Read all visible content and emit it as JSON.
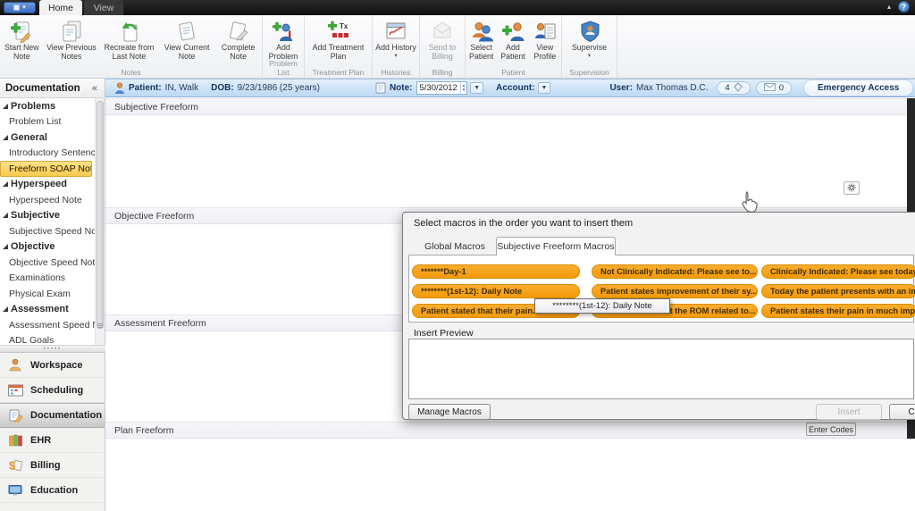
{
  "titlebar": {
    "tabs": [
      {
        "label": "Home",
        "active": true
      },
      {
        "label": "View",
        "active": false
      }
    ]
  },
  "glyphs": {
    "chevron_down": "▾",
    "collapse_caret": "▴",
    "question": "?",
    "spinner_up": "▲",
    "spinner_down": "▼",
    "left_chevrons": "«",
    "splitter_dots": "•••••"
  },
  "icons": [
    "new-note-icon",
    "previous-notes-icon",
    "recreate-note-icon",
    "current-note-icon",
    "complete-note-icon",
    "add-problem-icon",
    "add-treatment-plan-icon",
    "add-history-icon",
    "send-to-billing-icon",
    "select-patient-icon",
    "add-patient-icon",
    "view-profile-icon",
    "supervise-icon",
    "patient-icon",
    "note-icon",
    "tag-icon",
    "envelope-icon",
    "gear-icon",
    "hand-cursor"
  ],
  "ribbon": {
    "groups": [
      {
        "label": "Notes",
        "buttons": [
          {
            "label": "Start New Note"
          },
          {
            "label": "View Previous Notes"
          },
          {
            "label": "Recreate from Last Note"
          },
          {
            "label": "View Current Note"
          },
          {
            "label": "Complete Note"
          }
        ]
      },
      {
        "label": "Problem List",
        "buttons": [
          {
            "label": "Add Problem"
          }
        ]
      },
      {
        "label": "Treatment Plan",
        "buttons": [
          {
            "label": "Add Treatment Plan"
          }
        ]
      },
      {
        "label": "Histories",
        "buttons": [
          {
            "label": "Add History",
            "dropdown": true
          }
        ]
      },
      {
        "label": "Billing",
        "buttons": [
          {
            "label": "Send to Billing",
            "disabled": true
          }
        ]
      },
      {
        "label": "Patient",
        "buttons": [
          {
            "label": "Select Patient"
          },
          {
            "label": "Add Patient"
          },
          {
            "label": "View Profile"
          }
        ]
      },
      {
        "label": "Supervision",
        "buttons": [
          {
            "label": "Supervise",
            "dropdown": true
          }
        ]
      }
    ]
  },
  "patient_bar": {
    "patient_label": "Patient:",
    "patient_value": "IN, Walk",
    "dob_label": "DOB:",
    "dob_value": "9/23/1986 (25 years)",
    "note_label": "Note:",
    "note_value": "5/30/2012",
    "account_label": "Account:",
    "user_label": "User:",
    "user_value": "Max Thomas D.C.",
    "notifications_count": "4",
    "messages_count": "0",
    "emergency_access_button": "Emergency Access"
  },
  "sidebar": {
    "title": "Documentation",
    "items": [
      {
        "label": "Problems",
        "type": "header"
      },
      {
        "label": "Problem List",
        "type": "item"
      },
      {
        "label": "General",
        "type": "header"
      },
      {
        "label": "Introductory Sentence",
        "type": "item"
      },
      {
        "label": "Freeform SOAP Note",
        "type": "item",
        "selected": true
      },
      {
        "label": "Hyperspeed",
        "type": "header"
      },
      {
        "label": "Hyperspeed Note",
        "type": "item"
      },
      {
        "label": "Subjective",
        "type": "header"
      },
      {
        "label": "Subjective Speed Note",
        "type": "item"
      },
      {
        "label": "Objective",
        "type": "header"
      },
      {
        "label": "Objective Speed Note",
        "type": "item"
      },
      {
        "label": "Examinations",
        "type": "item"
      },
      {
        "label": "Physical Exam",
        "type": "item"
      },
      {
        "label": "Assessment",
        "type": "header"
      },
      {
        "label": "Assessment Speed No",
        "type": "item"
      },
      {
        "label": "ADL Goals",
        "type": "item"
      }
    ],
    "nav": [
      {
        "label": "Workspace"
      },
      {
        "label": "Scheduling"
      },
      {
        "label": "Documentation",
        "selected": true
      },
      {
        "label": "EHR"
      },
      {
        "label": "Billing"
      },
      {
        "label": "Education"
      }
    ]
  },
  "main": {
    "sections": [
      {
        "title": "Subjective Freeform"
      },
      {
        "title": "Objective Freeform"
      },
      {
        "title": "Assessment Freeform"
      },
      {
        "title": "Plan Freeform"
      }
    ],
    "enter_codes_button": "Enter Codes"
  },
  "macro_dialog": {
    "title": "Select macros in the order you want to insert them",
    "tabs": [
      {
        "label": "Global Macros",
        "active": false
      },
      {
        "label": "Subjective Freeform Macros",
        "active": true
      }
    ],
    "macros": [
      [
        "*******Day-1",
        "Not Clinically Indicated:  Please see to...",
        "Clinically Indicated:  Please see today's..."
      ],
      [
        "********(1st-12): Daily Note",
        "Patient states improvement of their sy...",
        "Today the patient presents with an im..."
      ],
      [
        "Patient stated that their pain...",
        "Patient stated that the ROM related to...",
        "Patient states their pain in much impr..."
      ]
    ],
    "tooltip": "********(1st-12): Daily Note",
    "insert_preview_label": "Insert Preview",
    "manage_macros_button": "Manage Macros",
    "insert_button": "Insert",
    "cancel_button": "Cancel"
  },
  "colors": {
    "macro_pill": "#F29A0C",
    "selected_sidebar_item": "#F9C94E",
    "patient_bar": "#BCD9F4",
    "accent_blue": "#3F7FC4",
    "titlebar": "#101010"
  }
}
